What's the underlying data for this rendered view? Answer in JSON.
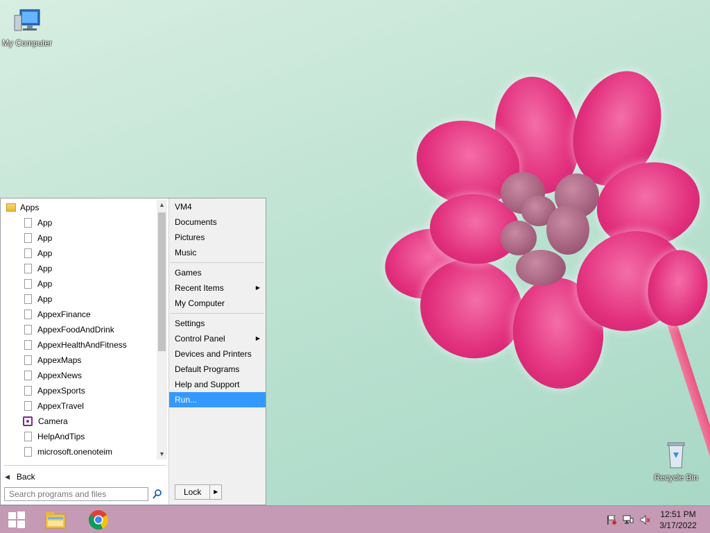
{
  "desktop": {
    "icons": [
      {
        "label": "My Computer",
        "icon": "computer-icon"
      },
      {
        "label": "Recycle Bin",
        "icon": "recycle-bin-icon"
      }
    ]
  },
  "start_menu": {
    "programs": {
      "folder": {
        "label": "Apps",
        "icon": "folder-icon"
      },
      "items": [
        {
          "label": "App",
          "icon": "file-icon"
        },
        {
          "label": "App",
          "icon": "file-icon"
        },
        {
          "label": "App",
          "icon": "file-icon"
        },
        {
          "label": "App",
          "icon": "file-icon"
        },
        {
          "label": "App",
          "icon": "file-icon"
        },
        {
          "label": "App",
          "icon": "file-icon"
        },
        {
          "label": "AppexFinance",
          "icon": "file-icon"
        },
        {
          "label": "AppexFoodAndDrink",
          "icon": "file-icon"
        },
        {
          "label": "AppexHealthAndFitness",
          "icon": "file-icon"
        },
        {
          "label": "AppexMaps",
          "icon": "file-icon"
        },
        {
          "label": "AppexNews",
          "icon": "file-icon"
        },
        {
          "label": "AppexSports",
          "icon": "file-icon"
        },
        {
          "label": "AppexTravel",
          "icon": "file-icon"
        },
        {
          "label": "Camera",
          "icon": "camera-icon"
        },
        {
          "label": "HelpAndTips",
          "icon": "file-icon"
        },
        {
          "label": "microsoft.onenoteim",
          "icon": "file-icon"
        }
      ]
    },
    "back_label": "Back",
    "search": {
      "placeholder": "Search programs and files",
      "value": ""
    },
    "right_items": {
      "vm4": "VM4",
      "documents": "Documents",
      "pictures": "Pictures",
      "music": "Music",
      "games": "Games",
      "recent_items": "Recent Items",
      "my_computer": "My Computer",
      "settings": "Settings",
      "control_panel": "Control Panel",
      "devices_printers": "Devices and Printers",
      "default_programs": "Default Programs",
      "help_support": "Help and Support",
      "run": "Run..."
    },
    "lock_label": "Lock"
  },
  "taskbar": {
    "clock": {
      "time": "12:51 PM",
      "date": "3/17/2022"
    }
  },
  "colors": {
    "selection": "#3399ff",
    "taskbar": "#c49ab4",
    "flower": "#e2307d"
  }
}
